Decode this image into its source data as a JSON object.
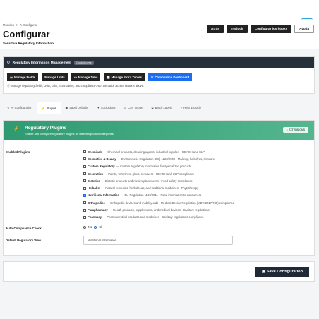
{
  "header": {
    "breadcrumb": [
      "Módulos",
      ">",
      "✎ Configurar"
    ],
    "title": "Configurar",
    "subtitle": "Sensitive Regulatory Information",
    "actions": [
      "Atrás",
      "Traducir",
      "Configurar los hooks",
      "Ayuda"
    ]
  },
  "rim": {
    "title": "Regulatory Information Management",
    "badge": "Quick Access",
    "buttons": [
      "Manage Fields",
      "Manage Units",
      "Manage Tabs",
      "Manage Extra Tables",
      "Compliance Dashboard"
    ],
    "note": "Manage regulatory fields, units, tabs, extra tables, and compliance from the quick access buttons above."
  },
  "tabs": [
    "AI Configuration",
    "Plugins",
    "Label Defaults",
    "Exclusions",
    "CSV Import",
    "Batch Labels",
    "Help & Guide"
  ],
  "plugins_panel": {
    "title": "Regulatory Plugins",
    "subtitle": "Enable and configure regulatory plugins for different product categories",
    "extensions_label": "EXTENSIONS",
    "enabled_label": "Enabled Plugins",
    "plugins": [
      {
        "name": "Chemicals",
        "desc": "— Chemical products, cleaning agents, industrial supplies - REACH and CLP",
        "checked": false
      },
      {
        "name": "Cosmetics & Beauty",
        "desc": "— EU Cosmetic Regulation (EC) 1223/2009 - Makeup, hair dyes, skincare",
        "checked": false
      },
      {
        "name": "Custom Regulatory",
        "desc": "— Custom regulatory information for specialized products",
        "checked": false
      },
      {
        "name": "Decoration",
        "desc": "— Paints, varnishes, glues, removers - REACH and CLP compliance",
        "checked": false
      },
      {
        "name": "Dietetics",
        "desc": "— Dietetic products and meal replacements - Food safety compliance",
        "checked": false
      },
      {
        "name": "Herbalist",
        "desc": "— Natural remedies, herbal teas, and traditional medicines - Phytotherapy",
        "checked": false
      },
      {
        "name": "Nutritional Information",
        "desc": "— EU Regulation 1169/2011 - Food information to consumers",
        "checked": true
      },
      {
        "name": "Orthopedics",
        "desc": "— Orthopedic devices and mobility aids - Medical Device Regulation (MDR 2017/745) compliance",
        "checked": false
      },
      {
        "name": "Parapharmacy",
        "desc": "— Health products, supplements, and medical devices - Sanitary regulations",
        "checked": false
      },
      {
        "name": "Pharmacy",
        "desc": "— Pharmaceutical products and medicines - Sanitary regulations compliance",
        "checked": false
      }
    ],
    "auto_label": "Auto-Compliance Check",
    "radio_no": "No",
    "radio_si": "Sí",
    "auto_value": "Sí",
    "default_label": "Default Regulatory View",
    "default_value": "Nutritional Information"
  },
  "save_label": "Save Configuration"
}
